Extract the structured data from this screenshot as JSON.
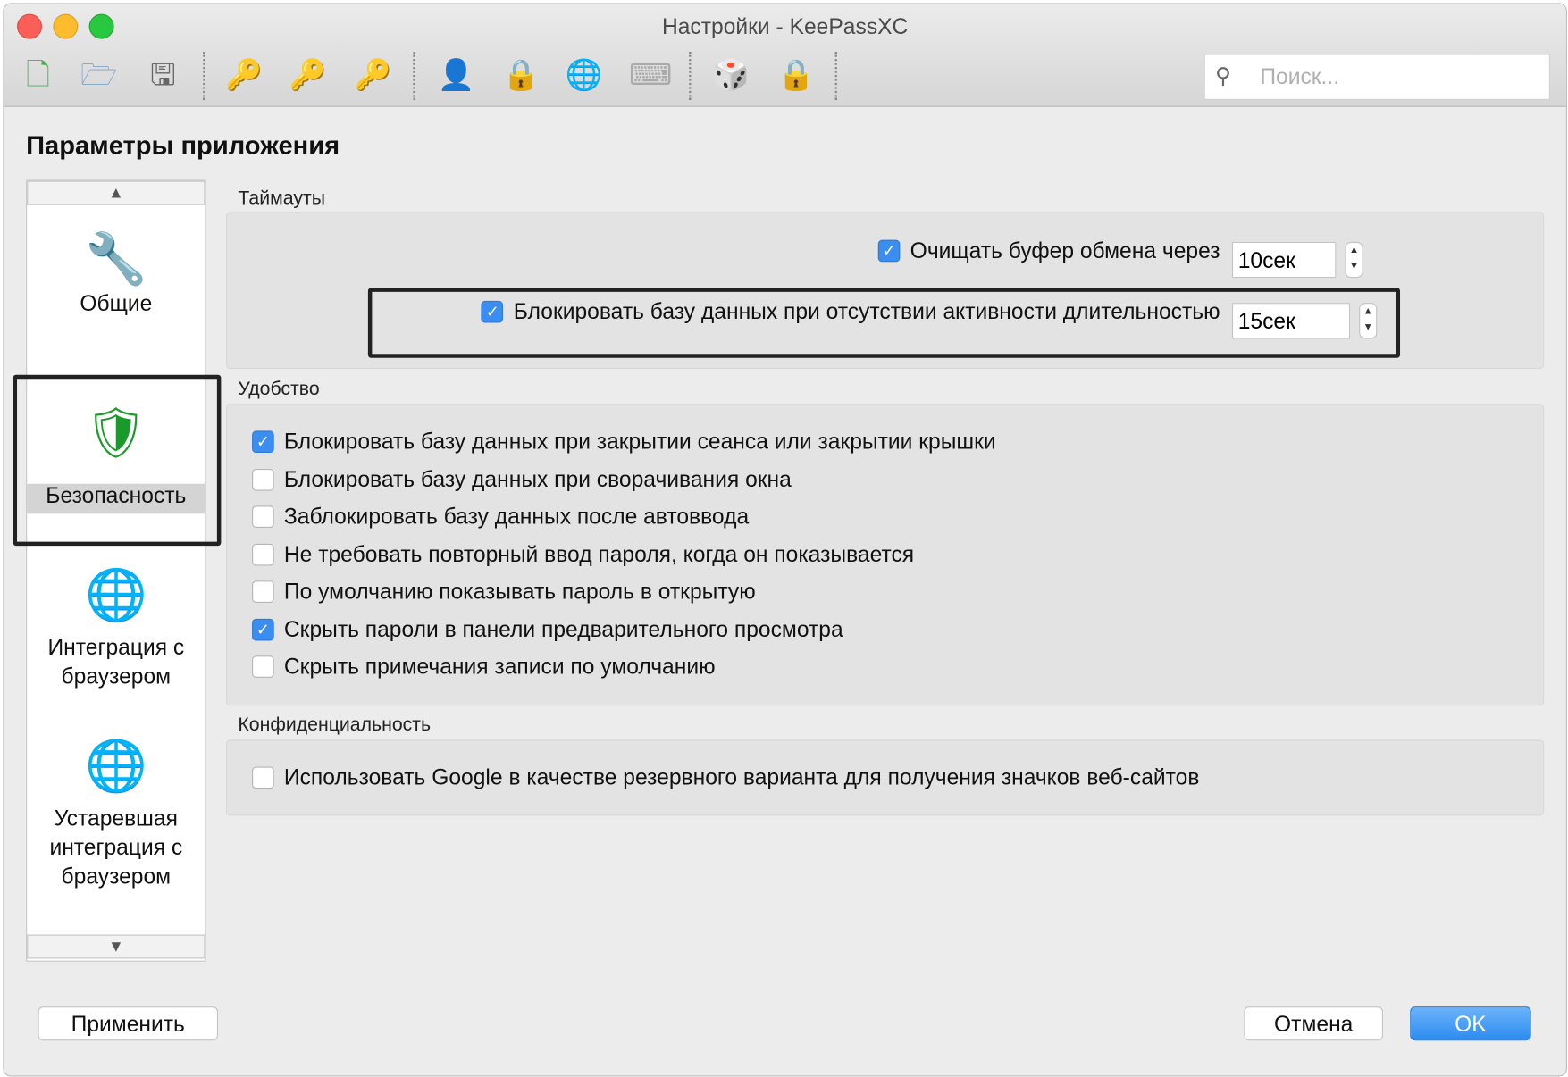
{
  "window": {
    "title": "Настройки - KeePassXC"
  },
  "toolbar": {
    "icons": [
      "new-database-icon",
      "open-database-icon",
      "save-database-icon",
      "add-entry-icon",
      "edit-entry-icon",
      "delete-entry-icon",
      "copy-username-icon",
      "copy-password-icon",
      "open-url-icon",
      "autotype-icon",
      "password-generator-icon",
      "lock-database-icon"
    ],
    "search_placeholder": "Поиск..."
  },
  "heading": "Параметры приложения",
  "sidebar": {
    "items": [
      {
        "label": "Общие",
        "icon": "wrench-gear-icon"
      },
      {
        "label": "Безопасность",
        "icon": "shield-icon",
        "selected": true
      },
      {
        "label": "Интеграция с браузером",
        "line1": "Интеграция с",
        "line2": "браузером",
        "icon": "globe-icon"
      },
      {
        "label": "Устаревшая интеграция с браузером",
        "line1": "Устаревшая",
        "line2": "интеграция с",
        "line3": "браузером",
        "icon": "globe-icon"
      }
    ]
  },
  "timeouts": {
    "title": "Таймауты",
    "clear_clipboard": {
      "label": "Очищать буфер обмена через",
      "checked": true,
      "value": "10сек"
    },
    "lock_inactivity": {
      "label": "Блокировать базу данных при отсутствии активности длительностью",
      "checked": true,
      "value": "15сек"
    }
  },
  "convenience": {
    "title": "Удобство",
    "items": [
      {
        "label": "Блокировать базу данных при закрытии сеанса или закрытии крышки",
        "checked": true
      },
      {
        "label": "Блокировать базу данных при сворачивания окна",
        "checked": false
      },
      {
        "label": "Заблокировать базу данных после автоввода",
        "checked": false
      },
      {
        "label": "Не требовать повторный ввод пароля, когда он показывается",
        "checked": false
      },
      {
        "label": "По умолчанию показывать пароль в открытую",
        "checked": false
      },
      {
        "label": "Скрыть пароли в панели предварительного просмотра",
        "checked": true
      },
      {
        "label": "Скрыть примечания записи по умолчанию",
        "checked": false
      }
    ]
  },
  "privacy": {
    "title": "Конфиденциальность",
    "items": [
      {
        "label": "Использовать Google в качестве резервного варианта для получения значков веб-сайтов",
        "checked": false
      }
    ]
  },
  "buttons": {
    "apply": "Применить",
    "cancel": "Отмена",
    "ok": "OK"
  },
  "colors": {
    "accent": "#3b8ef0"
  }
}
